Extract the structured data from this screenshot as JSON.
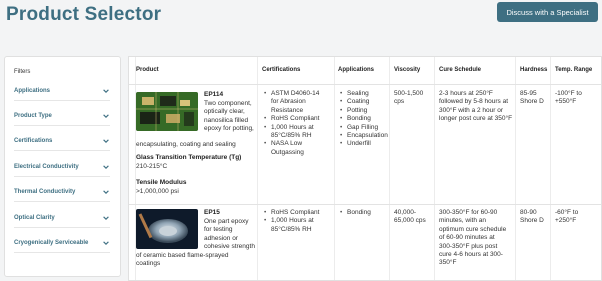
{
  "page": {
    "title": "Product Selector",
    "cta_label": "Discuss with a Specialist"
  },
  "filters": {
    "title": "Filters",
    "items": [
      {
        "label": "Applications"
      },
      {
        "label": "Product Type"
      },
      {
        "label": "Certifications"
      },
      {
        "label": "Electrical Conductivity"
      },
      {
        "label": "Thermal Conductivity"
      },
      {
        "label": "Optical Clarity"
      },
      {
        "label": "Cryogenically Serviceable"
      }
    ]
  },
  "table": {
    "headers": {
      "product": "Product",
      "certifications": "Certifications",
      "applications": "Applications",
      "viscosity": "Viscosity",
      "cure_schedule": "Cure Schedule",
      "hardness": "Hardness",
      "temp_range": "Temp. Range"
    },
    "rows": [
      {
        "name": "EP114",
        "desc_short": [
          "Two component,",
          "optically clear,",
          "nanosilica filled",
          "epoxy for potting,"
        ],
        "desc_long": "encapsulating, coating and sealing",
        "extra": [
          {
            "label": "Glass Transition Temperature (Tg)",
            "value": "210-215°C"
          },
          {
            "label": "Tensile Modulus",
            "value": ">1,000,000 psi"
          }
        ],
        "certifications": [
          [
            "ASTM D4060-14",
            "for Abrasion",
            "Resistance"
          ],
          [
            "RoHS Compliant"
          ],
          [
            "1,000 Hours at",
            "85°C/85% RH"
          ],
          [
            "NASA Low",
            "Outgassing"
          ]
        ],
        "applications": [
          "Sealing",
          "Coating",
          "Potting",
          "Bonding",
          "Gap Filling",
          "Encapsulation",
          "Underfill"
        ],
        "viscosity": [
          "500-1,500",
          "cps"
        ],
        "cure_schedule": [
          "2-3 hours at 250°F",
          "followed by 5-8 hours at",
          "300°F with a 2 hour or",
          "longer post cure at 350°F"
        ],
        "hardness": [
          "85-95",
          "Shore D"
        ],
        "temp_range": [
          "-100°F to",
          "+550°F"
        ]
      },
      {
        "name": "EP15",
        "desc_short": [
          "One part epoxy",
          "for testing",
          "adhesion or",
          "cohesive strength"
        ],
        "desc_long": [
          "of ceramic based flame-sprayed",
          "coatings"
        ],
        "certifications": [
          [
            "RoHS Compliant"
          ],
          [
            "1,000 Hours at",
            "85°C/85% RH"
          ]
        ],
        "applications": [
          "Bonding"
        ],
        "viscosity": [
          "40,000-",
          "65,000 cps"
        ],
        "cure_schedule": [
          "300-350°F for 60-90",
          "minutes, with an",
          "optimum cure schedule",
          "of 60-90 minutes at",
          "300-350°F plus post",
          "cure 4-6 hours at 300-",
          "350°F"
        ],
        "hardness": [
          "80-90",
          "Shore D"
        ],
        "temp_range": [
          "-60°F to",
          "+250°F"
        ]
      }
    ]
  }
}
